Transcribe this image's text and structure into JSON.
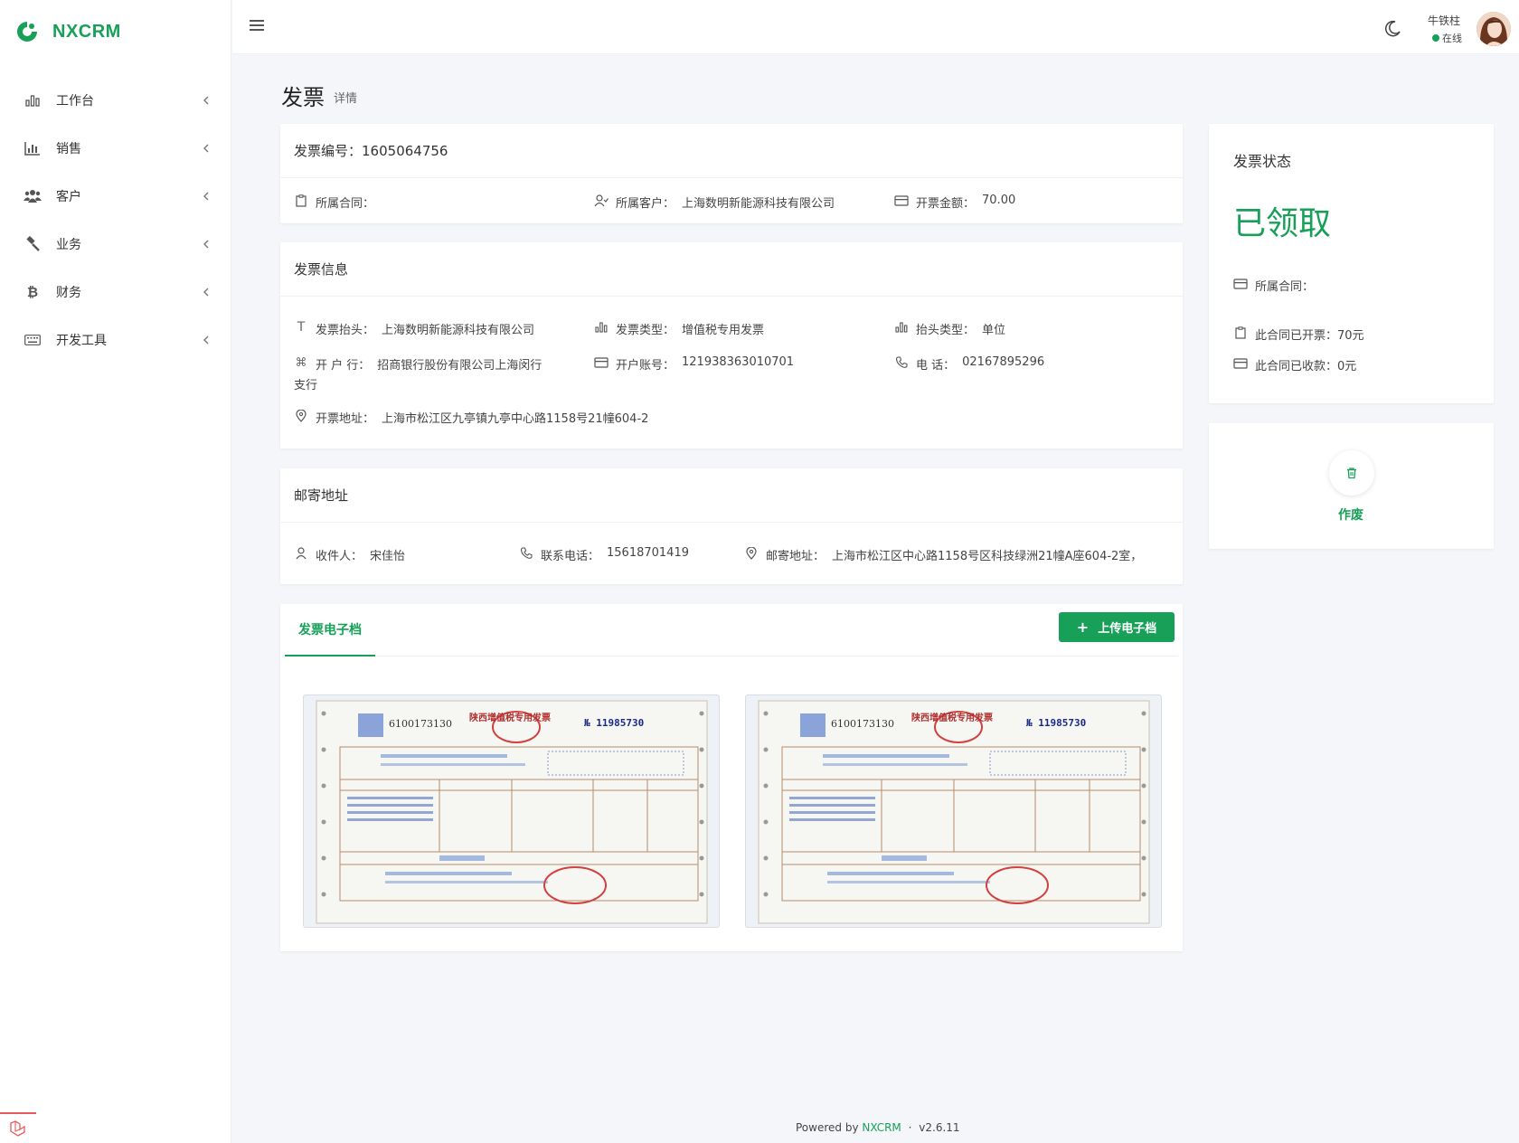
{
  "brand": {
    "name": "NXCRM",
    "accent": "#18a058"
  },
  "sidebar": {
    "items": [
      {
        "label": "工作台",
        "icon": "bar-chart-icon"
      },
      {
        "label": "销售",
        "icon": "chart-icon"
      },
      {
        "label": "客户",
        "icon": "users-icon"
      },
      {
        "label": "业务",
        "icon": "gavel-icon"
      },
      {
        "label": "财务",
        "icon": "bitcoin-icon"
      },
      {
        "label": "开发工具",
        "icon": "keyboard-icon"
      }
    ]
  },
  "header": {
    "user_name": "牛铁柱",
    "user_status": "在线"
  },
  "page": {
    "title": "发票",
    "subtitle": "详情"
  },
  "summary": {
    "invoice_no_label": "发票编号：",
    "invoice_no": "1605064756",
    "contract_label": "所属合同：",
    "contract": "",
    "customer_label": "所属客户：",
    "customer": "上海数明新能源科技有限公司",
    "amount_label": "开票金额：",
    "amount": "70.00"
  },
  "invoice_info": {
    "header": "发票信息",
    "title_label": "发票抬头：",
    "title": "上海数明新能源科技有限公司",
    "type_label": "发票类型：",
    "type": "增值税专用发票",
    "title_type_label": "抬头类型：",
    "title_type": "单位",
    "bank_label": "开 户 行：",
    "bank_line1": "招商银行股份有限公司上海闵行",
    "bank_line2": "支行",
    "account_label": "开户账号：",
    "account": "121938363010701",
    "phone_label": "电 话：",
    "phone": "02167895296",
    "address_label": "开票地址：",
    "address": "上海市松江区九亭镇九亭中心路1158号21幢604-2"
  },
  "mailing": {
    "header": "邮寄地址",
    "recipient_label": "收件人：",
    "recipient": "宋佳怡",
    "phone_label": "联系电话：",
    "phone": "15618701419",
    "address_label": "邮寄地址：",
    "address": "上海市松江区中心路1158号区科技绿洲21幢A座604-2室，"
  },
  "files": {
    "tab_label": "发票电子档",
    "upload_label": "上传电子档",
    "invoices": [
      {
        "code": "6100173130",
        "title": "陕西增值税专用发票",
        "number": "№ 11985730"
      },
      {
        "code": "6100173130",
        "title": "陕西增值税专用发票",
        "number": "№ 11985730"
      }
    ]
  },
  "status_panel": {
    "title": "发票状态",
    "value": "已领取",
    "contract_label": "所属合同：",
    "invoiced_label": "此合同已开票：",
    "invoiced": "70元",
    "received_label": "此合同已收款：",
    "received": "0元"
  },
  "actions": {
    "void_label": "作废"
  },
  "footer": {
    "powered": "Powered by",
    "brand": "NXCRM",
    "sep": "·",
    "version": "v2.6.11"
  }
}
